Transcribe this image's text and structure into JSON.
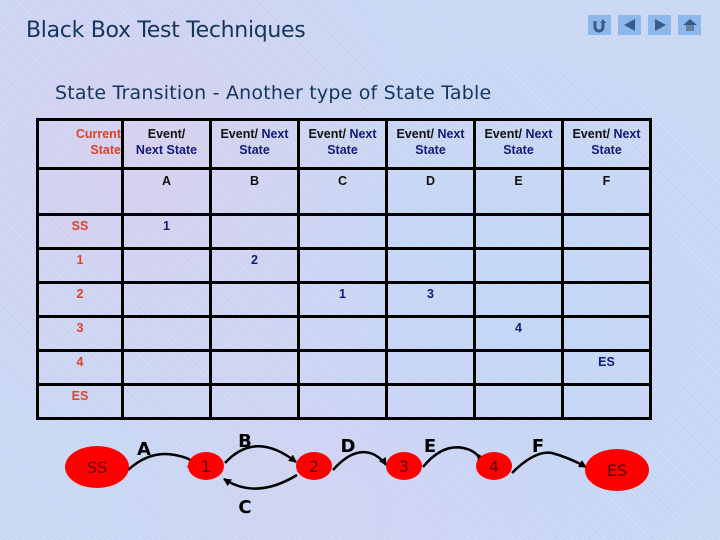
{
  "header": {
    "title": "Black Box Test Techniques",
    "subtitle": "State Transition - Another type of State Table"
  },
  "nav": {
    "buttons": [
      {
        "icon": "return-icon",
        "label": "Return"
      },
      {
        "icon": "previous-icon",
        "label": "Previous"
      },
      {
        "icon": "next-icon",
        "label": "Next"
      },
      {
        "icon": "home-icon",
        "label": "Home"
      }
    ]
  },
  "colors": {
    "title": "#13365f",
    "current_state_text": "#d9442a",
    "next_state_text": "#121a7a",
    "node_fill": "#ff0000",
    "nav_button": "#8cb8ec"
  },
  "table": {
    "header": {
      "current_state": [
        "Current",
        "State"
      ],
      "first_event": [
        "Event/",
        "Next State"
      ],
      "event_next": [
        "Event/ Next",
        "State"
      ]
    },
    "events": [
      "A",
      "B",
      "C",
      "D",
      "E",
      "F"
    ],
    "rows": [
      {
        "state": "SS",
        "cells": [
          "1",
          "",
          "",
          "",
          "",
          ""
        ]
      },
      {
        "state": "1",
        "cells": [
          "",
          "2",
          "",
          "",
          "",
          ""
        ]
      },
      {
        "state": "2",
        "cells": [
          "",
          "",
          "1",
          "3",
          "",
          ""
        ]
      },
      {
        "state": "3",
        "cells": [
          "",
          "",
          "",
          "",
          "4",
          ""
        ]
      },
      {
        "state": "4",
        "cells": [
          "",
          "",
          "",
          "",
          "",
          "ES"
        ]
      },
      {
        "state": "ES",
        "cells": [
          "",
          "",
          "",
          "",
          "",
          ""
        ]
      }
    ]
  },
  "diagram": {
    "nodes": [
      "SS",
      "1",
      "2",
      "3",
      "4",
      "ES"
    ],
    "transitions": [
      {
        "from": "SS",
        "to": "1",
        "event": "A"
      },
      {
        "from": "1",
        "to": "2",
        "event": "B"
      },
      {
        "from": "2",
        "to": "1",
        "event": "C"
      },
      {
        "from": "2",
        "to": "3",
        "event": "D"
      },
      {
        "from": "3",
        "to": "4",
        "event": "E"
      },
      {
        "from": "4",
        "to": "ES",
        "event": "F"
      }
    ]
  }
}
